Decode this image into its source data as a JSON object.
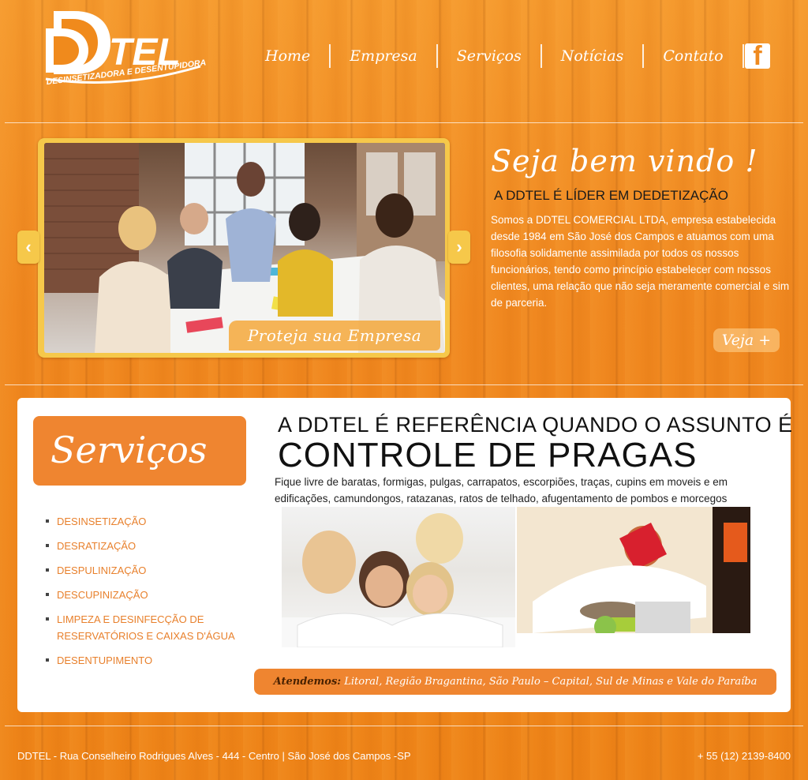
{
  "brand": {
    "logo_text": "DDTEL",
    "logo_tagline": "DESINSETIZADORA E DESENTUPIDORA"
  },
  "nav": {
    "items": [
      {
        "label": "Home"
      },
      {
        "label": "Empresa"
      },
      {
        "label": "Serviços"
      },
      {
        "label": "Notícias"
      },
      {
        "label": "Contato"
      }
    ],
    "facebook_icon": "facebook-icon"
  },
  "slider": {
    "caption": "Proteja sua Empresa",
    "prev_icon": "chevron-left-icon",
    "next_icon": "chevron-right-icon",
    "prev_glyph": "‹",
    "next_glyph": "›"
  },
  "welcome": {
    "title": "Seja bem vindo !",
    "subtitle": "A DDTEL É LÍDER EM DEDETIZAÇÃO",
    "body": "Somos a DDTEL COMERCIAL LTDA, empresa estabelecida desde 1984 em São José dos Campos e atuamos com uma filosofia solidamente assimilada por todos os nossos funcionários, tendo como princípio estabelecer com nossos clientes, uma relação que não seja meramente comercial e sim de parceria.",
    "more_label": "Veja +"
  },
  "services": {
    "heading": "Serviços",
    "items": [
      "DESINSETIZAÇÃO",
      "DESRATIZAÇÃO",
      "DESPULINIZAÇÃO",
      "DESCUPINIZAÇÃO",
      "LIMPEZA E DESINFECÇÃO DE RESERVATÓRIOS E CAIXAS D'ÁGUA",
      "DESENTUPIMENTO"
    ]
  },
  "reference": {
    "line1": "A DDTEL É REFERÊNCIA QUANDO O ASSUNTO É",
    "line2": "CONTROLE DE PRAGAS",
    "text": "Fique livre de baratas, formigas, pulgas, carrapatos, escorpiões, traças, cupins em moveis e em edificações, camundongos, ratazanas, ratos de telhado, afugentamento de pombos e morcegos"
  },
  "service_area": {
    "label": "Atendemos:",
    "text": "Litoral, Região Bragantina, São Paulo – Capital, Sul de Minas e Vale do Paraíba"
  },
  "footer": {
    "address": "DDTEL - Rua Conselheiro Rodrigues Alves - 444 - Centro | São José dos Campos -SP",
    "phone": "+ 55 (12) 2139-8400"
  },
  "colors": {
    "accent": "#ef8530",
    "wood_orange": "#f08a1c",
    "slider_frame": "#f6c84a",
    "link": "#e8802c"
  }
}
